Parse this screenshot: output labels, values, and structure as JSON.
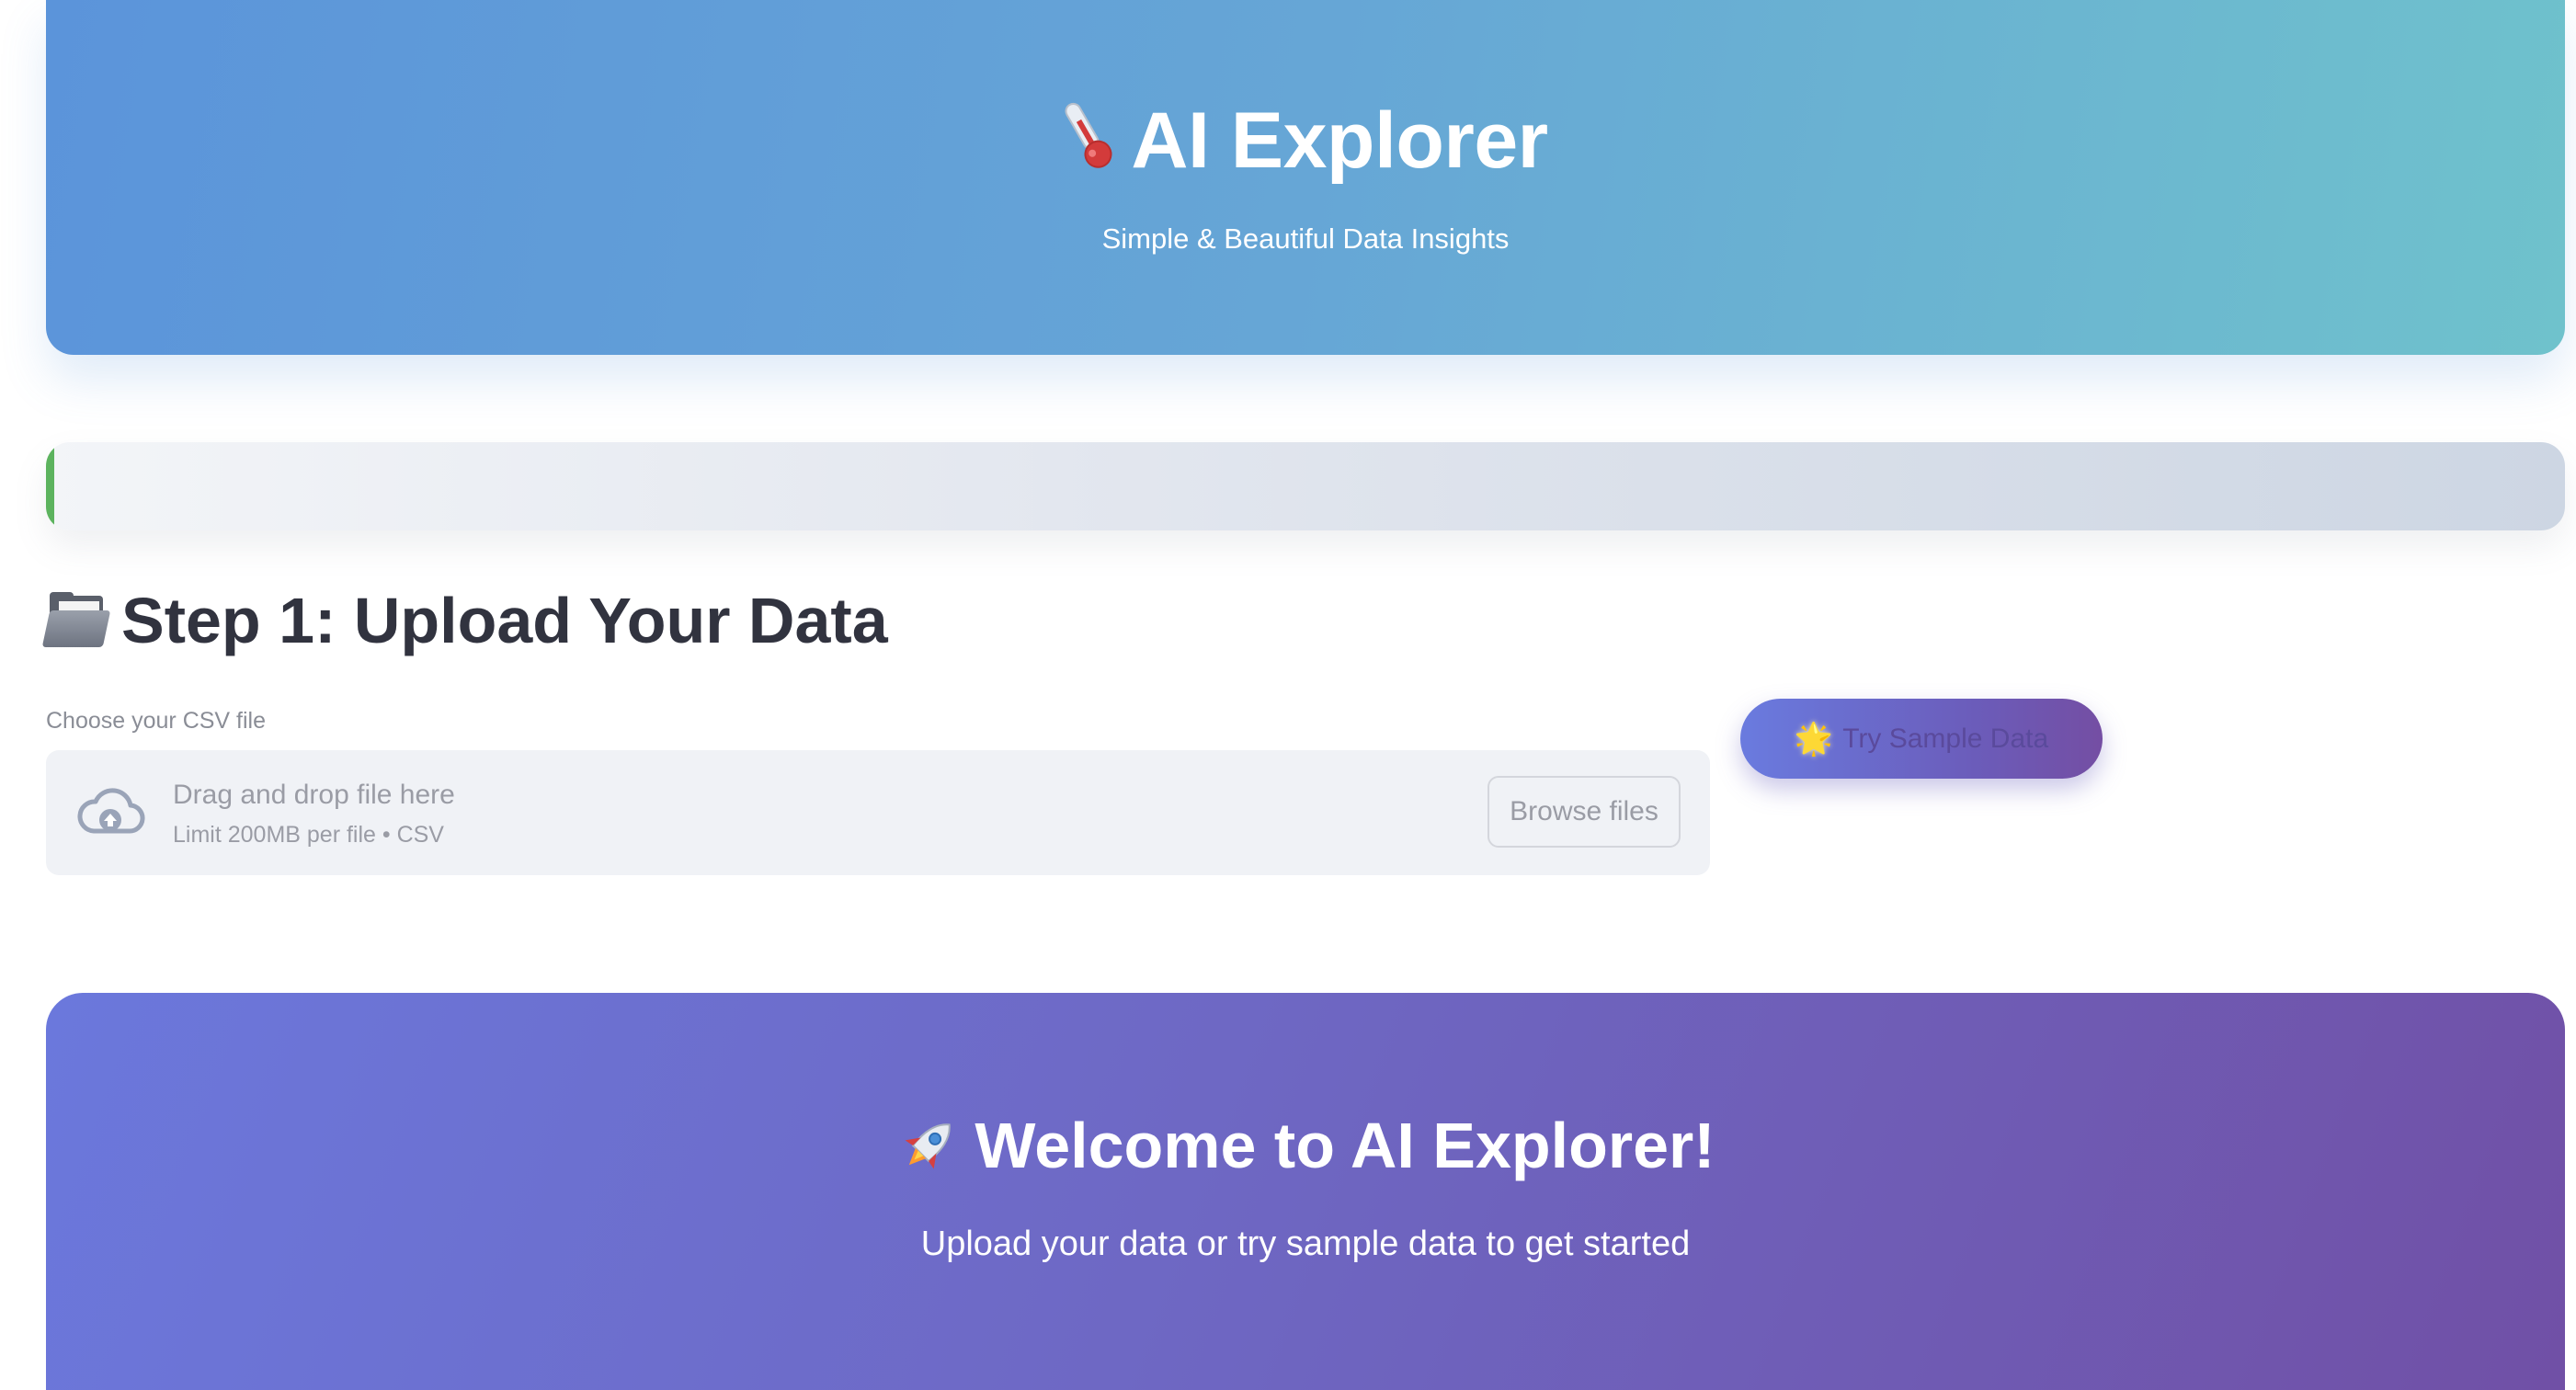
{
  "header": {
    "title": "AI Explorer",
    "title_icon": "thermometer-icon",
    "subtitle": "Simple & Beautiful Data Insights",
    "colors": {
      "gradient_start": "#5b94da",
      "gradient_end": "#6fc2cc"
    }
  },
  "status_bar": {
    "accent_color": "#5cb35e"
  },
  "step1": {
    "icon": "folder-icon",
    "heading": "Step 1: Upload Your Data"
  },
  "uploader": {
    "label": "Choose your CSV file",
    "drop_text": "Drag and drop file here",
    "limit_text": "Limit 200MB per file • CSV",
    "browse_label": "Browse files",
    "icon": "cloud-upload-icon"
  },
  "sample_button": {
    "icon": "star-icon",
    "icon_glyph": "🌟",
    "label": "Try Sample Data"
  },
  "welcome": {
    "icon": "rocket-icon",
    "title": "Welcome to AI Explorer!",
    "subtitle": "Upload your data or try sample data to get started",
    "colors": {
      "gradient_start": "#6b78dc",
      "gradient_end": "#7050a6"
    }
  }
}
